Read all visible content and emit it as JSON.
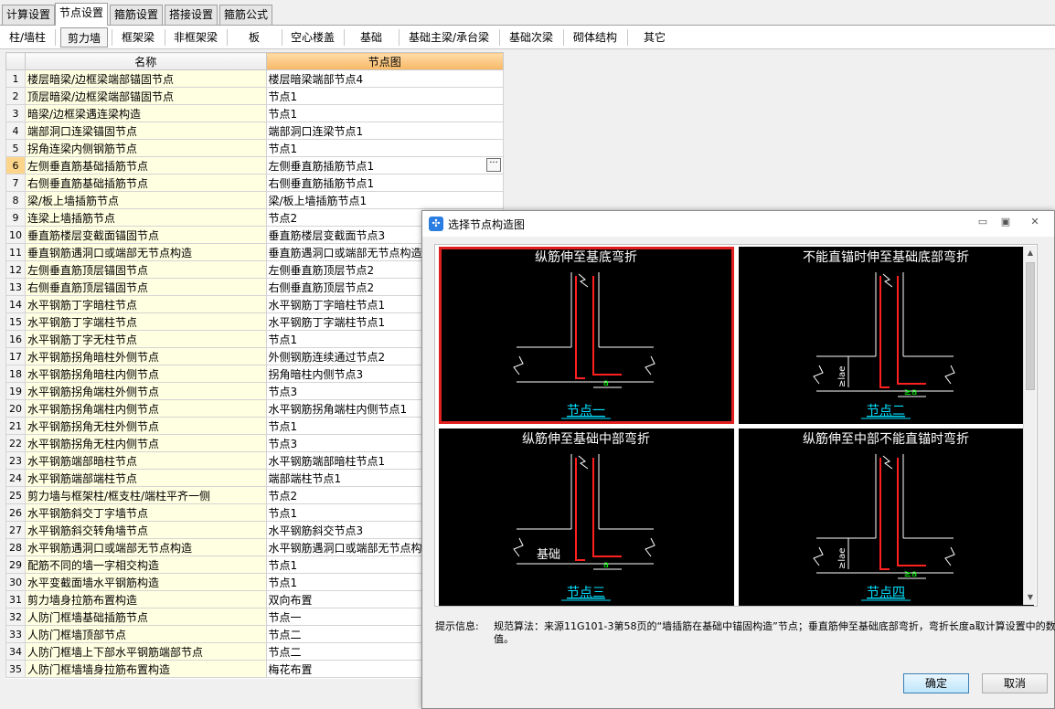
{
  "top_tabs": [
    "计算设置",
    "节点设置",
    "箍筋设置",
    "搭接设置",
    "箍筋公式"
  ],
  "sub_tabs": [
    "柱/墙柱",
    "剪力墙",
    "框架梁",
    "非框架梁",
    "板",
    "空心楼盖",
    "基础",
    "基础主梁/承台梁",
    "基础次梁",
    "砌体结构",
    "其它"
  ],
  "table": {
    "headers": {
      "num": "",
      "name": "名称",
      "node": "节点图"
    },
    "rows": [
      {
        "n": "1",
        "name": "楼层暗梁/边框梁端部锚固节点",
        "node": "楼层暗梁端部节点4"
      },
      {
        "n": "2",
        "name": "顶层暗梁/边框梁端部锚固节点",
        "node": "节点1"
      },
      {
        "n": "3",
        "name": "暗梁/边框梁遇连梁构造",
        "node": "节点1"
      },
      {
        "n": "4",
        "name": "端部洞口连梁锚固节点",
        "node": "端部洞口连梁节点1"
      },
      {
        "n": "5",
        "name": "拐角连梁内侧钢筋节点",
        "node": "节点1"
      },
      {
        "n": "6",
        "name": "左侧垂直筋基础插筋节点",
        "node": "左侧垂直筋插筋节点1"
      },
      {
        "n": "7",
        "name": "右侧垂直筋基础插筋节点",
        "node": "右侧垂直筋插筋节点1"
      },
      {
        "n": "8",
        "name": "梁/板上墙插筋节点",
        "node": "梁/板上墙插筋节点1"
      },
      {
        "n": "9",
        "name": "连梁上墙插筋节点",
        "node": "节点2"
      },
      {
        "n": "10",
        "name": "垂直筋楼层变截面锚固节点",
        "node": "垂直筋楼层变截面节点3"
      },
      {
        "n": "11",
        "name": "垂直钢筋遇洞口或端部无节点构造",
        "node": "垂直筋遇洞口或端部无节点构造"
      },
      {
        "n": "12",
        "name": "左侧垂直筋顶层锚固节点",
        "node": "左侧垂直筋顶层节点2"
      },
      {
        "n": "13",
        "name": "右侧垂直筋顶层锚固节点",
        "node": "右侧垂直筋顶层节点2"
      },
      {
        "n": "14",
        "name": "水平钢筋丁字暗柱节点",
        "node": "水平钢筋丁字暗柱节点1"
      },
      {
        "n": "15",
        "name": "水平钢筋丁字端柱节点",
        "node": "水平钢筋丁字端柱节点1"
      },
      {
        "n": "16",
        "name": "水平钢筋丁字无柱节点",
        "node": "节点1"
      },
      {
        "n": "17",
        "name": "水平钢筋拐角暗柱外侧节点",
        "node": "外侧钢筋连续通过节点2"
      },
      {
        "n": "18",
        "name": "水平钢筋拐角暗柱内侧节点",
        "node": "拐角暗柱内侧节点3"
      },
      {
        "n": "19",
        "name": "水平钢筋拐角端柱外侧节点",
        "node": "节点3"
      },
      {
        "n": "20",
        "name": "水平钢筋拐角端柱内侧节点",
        "node": "水平钢筋拐角端柱内侧节点1"
      },
      {
        "n": "21",
        "name": "水平钢筋拐角无柱外侧节点",
        "node": "节点1"
      },
      {
        "n": "22",
        "name": "水平钢筋拐角无柱内侧节点",
        "node": "节点3"
      },
      {
        "n": "23",
        "name": "水平钢筋端部暗柱节点",
        "node": "水平钢筋端部暗柱节点1"
      },
      {
        "n": "24",
        "name": "水平钢筋端部端柱节点",
        "node": "端部端柱节点1"
      },
      {
        "n": "25",
        "name": "剪力墙与框架柱/框支柱/端柱平齐一侧",
        "node": "节点2"
      },
      {
        "n": "26",
        "name": "水平钢筋斜交丁字墙节点",
        "node": "节点1"
      },
      {
        "n": "27",
        "name": "水平钢筋斜交转角墙节点",
        "node": "水平钢筋斜交节点3"
      },
      {
        "n": "28",
        "name": "水平钢筋遇洞口或端部无节点构造",
        "node": "水平钢筋遇洞口或端部无节点构造"
      },
      {
        "n": "29",
        "name": "配筋不同的墙一字相交构造",
        "node": "节点1"
      },
      {
        "n": "30",
        "name": "水平变截面墙水平钢筋构造",
        "node": "节点1"
      },
      {
        "n": "31",
        "name": "剪力墙身拉筋布置构造",
        "node": "双向布置"
      },
      {
        "n": "32",
        "name": "人防门框墙基础插筋节点",
        "node": "节点一"
      },
      {
        "n": "33",
        "name": "人防门框墙顶部节点",
        "node": "节点二"
      },
      {
        "n": "34",
        "name": "人防门框墙上下部水平钢筋端部节点",
        "node": "节点二"
      },
      {
        "n": "35",
        "name": "人防门框墙墙身拉筋布置构造",
        "node": "梅花布置"
      }
    ],
    "selected_row": "6",
    "ellipsis": "···"
  },
  "dialog": {
    "title": "选择节点构造图",
    "nodes": [
      {
        "title": "纵筋伸至基底弯折",
        "label": "节点一",
        "dim_a": "a",
        "selected": true
      },
      {
        "title": "不能直锚时伸至基础底部弯折",
        "label": "节点二",
        "dim_a": "≥a",
        "dim_lae": "≥lae",
        "selected": false
      },
      {
        "title": "纵筋伸至基础中部弯折",
        "label": "节点三",
        "dim_a": "a",
        "base_text": "基础",
        "selected": false
      },
      {
        "title": "纵筋伸至中部不能直锚时弯折",
        "label": "节点四",
        "dim_a": "≥a",
        "dim_lae": "≥lae",
        "selected": false
      }
    ],
    "hint_label": "提示信息:",
    "hint_text": "规范算法：来源11G101-3第58页的“墙插筋在基础中锚固构造”节点；垂直筋伸至基础底部弯折，弯折长度a取计算设置中的数值。",
    "ok": "确定",
    "cancel": "取消"
  }
}
